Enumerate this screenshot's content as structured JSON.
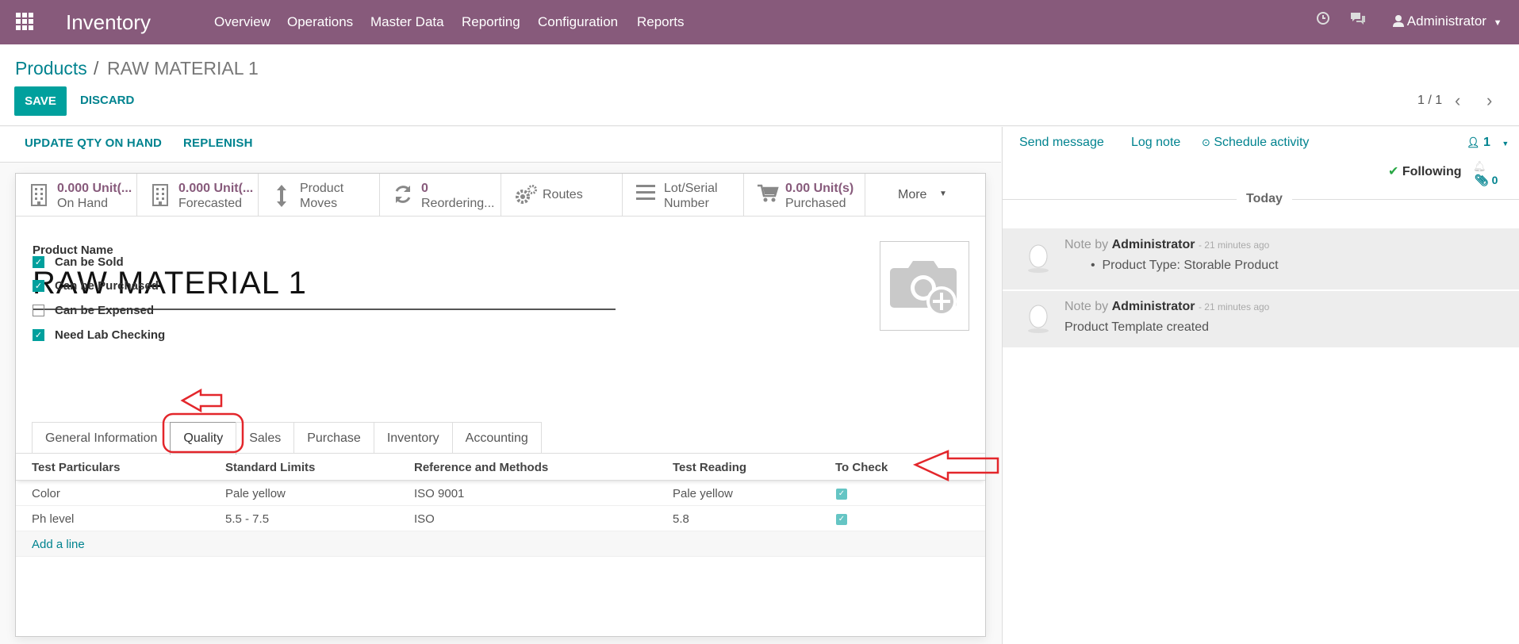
{
  "navbar": {
    "app_name": "Inventory",
    "menus": [
      "Overview",
      "Operations",
      "Master Data",
      "Reporting",
      "Configuration",
      "Reports"
    ],
    "user": "Administrator",
    "background": "#875a7b"
  },
  "breadcrumb": {
    "parent": "Products",
    "separator": "/",
    "current": "RAW MATERIAL 1"
  },
  "actions": {
    "save_label": "SAVE",
    "discard_label": "DISCARD"
  },
  "pager": {
    "text": "1 / 1"
  },
  "status_buttons": {
    "update_qty": "UPDATE QTY ON HAND",
    "replenish": "REPLENISH"
  },
  "smart_buttons": [
    {
      "value": "0.000 Unit(...",
      "label": "On Hand",
      "icon": "building-icon"
    },
    {
      "value": "0.000 Unit(...",
      "label": "Forecasted",
      "icon": "building-icon"
    },
    {
      "value": "Product",
      "label": "Moves",
      "icon": "updown-arrow-icon"
    },
    {
      "value": "0",
      "label": "Reordering...",
      "icon": "refresh-icon"
    },
    {
      "value": "Routes",
      "label": "",
      "icon": "cogs-icon"
    },
    {
      "value": "Lot/Serial",
      "label": "Number",
      "icon": "bars-icon"
    },
    {
      "value": "0.00 Unit(s)",
      "label": "Purchased",
      "icon": "cart-icon"
    }
  ],
  "more_label": "More",
  "product": {
    "name_label": "Product Name",
    "name": "RAW MATERIAL 1",
    "checkboxes": [
      {
        "label": "Can be Sold",
        "checked": true
      },
      {
        "label": "Can be Purchased",
        "checked": true
      },
      {
        "label": "Can be Expensed",
        "checked": false
      },
      {
        "label": "Need Lab Checking",
        "checked": true
      }
    ]
  },
  "tabs": [
    "General Information",
    "Quality",
    "Sales",
    "Purchase",
    "Inventory",
    "Accounting"
  ],
  "active_tab": "Quality",
  "quality_table": {
    "headers": [
      "Test Particulars",
      "Standard Limits",
      "Reference and Methods",
      "Test Reading",
      "To Check"
    ],
    "rows": [
      {
        "particular": "Color",
        "limits": "Pale yellow",
        "reference": "ISO 9001",
        "reading": "Pale yellow",
        "to_check": true
      },
      {
        "particular": "Ph level",
        "limits": "5.5 - 7.5",
        "reference": "ISO",
        "reading": "5.8",
        "to_check": true
      }
    ],
    "add_line": "Add a line"
  },
  "chatter": {
    "send_message": "Send message",
    "log_note": "Log note",
    "schedule_activity": "Schedule activity",
    "followers_count": "1",
    "following": "Following",
    "attachments_count": "0",
    "date_separator": "Today",
    "messages": [
      {
        "type": "Note by",
        "author": "Administrator",
        "time": "- 21 minutes ago",
        "body": "Product Type: Storable Product",
        "bullet": true
      },
      {
        "type": "Note by",
        "author": "Administrator",
        "time": "- 21 minutes ago",
        "body": "Product Template created",
        "bullet": false
      }
    ]
  },
  "colors": {
    "brand": "#875a7b",
    "accent": "#00a09d",
    "link": "#00838f",
    "annotation": "#e3262b"
  }
}
